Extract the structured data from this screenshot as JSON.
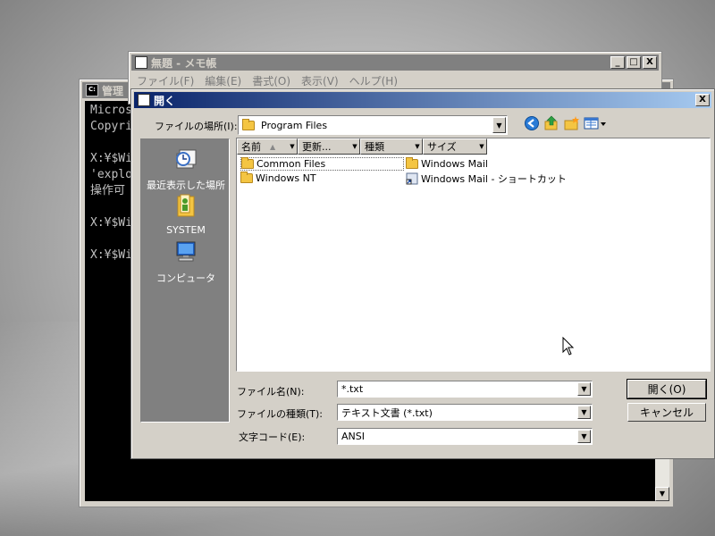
{
  "console": {
    "title": "管理",
    "lines": [
      "Micros",
      "Copyri",
      "",
      "X:¥$Wi",
      "'explo",
      "操作可",
      "",
      "X:¥$Wi",
      "",
      "X:¥$Wi"
    ]
  },
  "notepad": {
    "title": "無題 - メモ帳",
    "menu": [
      "ファイル(F)",
      "編集(E)",
      "書式(O)",
      "表示(V)",
      "ヘルプ(H)"
    ]
  },
  "dialog": {
    "title": "開く",
    "look_in_label": "ファイルの場所(I):",
    "look_in_value": "Program Files",
    "places": [
      {
        "label": "最近表示した場所",
        "icon": "recent-places-icon"
      },
      {
        "label": "SYSTEM",
        "icon": "user-folder-icon"
      },
      {
        "label": "コンピュータ",
        "icon": "computer-icon"
      }
    ],
    "columns": [
      "名前",
      "更新...",
      "種類",
      "サイズ"
    ],
    "files": [
      {
        "name": "Common Files",
        "icon": "folder-icon"
      },
      {
        "name": "Windows NT",
        "icon": "folder-icon"
      },
      {
        "name": "Windows Mail",
        "icon": "folder-icon"
      },
      {
        "name": "Windows Mail - ショートカット",
        "icon": "shortcut-icon"
      }
    ],
    "filename_label": "ファイル名(N):",
    "filename_value": "*.txt",
    "filetype_label": "ファイルの種類(T):",
    "filetype_value": "テキスト文書 (*.txt)",
    "encoding_label": "文字コード(E):",
    "encoding_value": "ANSI",
    "open_button": "開く(O)",
    "cancel_button": "キャンセル",
    "close_glyph": "X"
  },
  "window_buttons": {
    "minimize": "_",
    "maximize": "□",
    "close": "X"
  }
}
